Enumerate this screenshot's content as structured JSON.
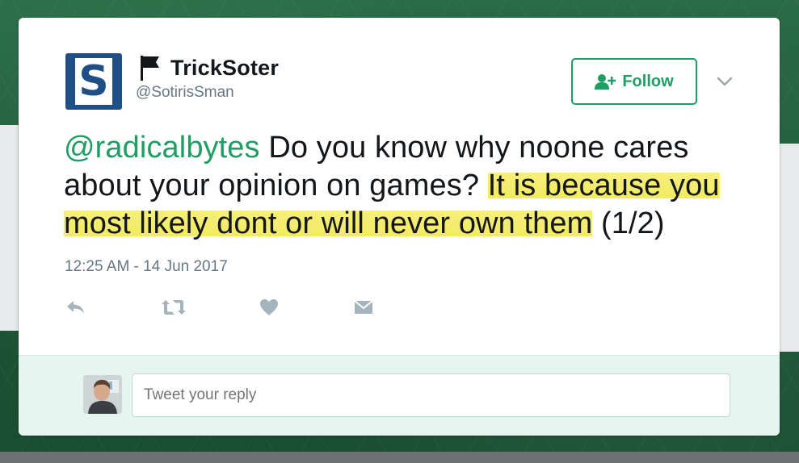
{
  "author": {
    "display_name": "TrickSoter",
    "handle": "@SotirisSman",
    "avatar_letter": "S",
    "verified_icon": "flag-icon"
  },
  "follow_button": {
    "label": "Follow",
    "icon": "add-user-icon"
  },
  "tweet": {
    "mention": "@radicalbytes",
    "text_plain": " Do you know why noone cares about your opinion on games? ",
    "text_highlighted": "It is because you most likely dont or will never own them",
    "text_suffix": " (1/2)",
    "timestamp": "12:25 AM - 14 Jun 2017"
  },
  "actions": [
    {
      "name": "reply",
      "icon": "reply-icon"
    },
    {
      "name": "retweet",
      "icon": "retweet-icon"
    },
    {
      "name": "like",
      "icon": "heart-icon"
    },
    {
      "name": "message",
      "icon": "envelope-icon"
    }
  ],
  "reply_box": {
    "placeholder": "Tweet your reply"
  },
  "colors": {
    "accent": "#1f9e64",
    "muted": "#657786",
    "highlight": "#f3ea63",
    "reply_bg": "#e6f5ef",
    "avatar_bg": "#1f4f86"
  }
}
